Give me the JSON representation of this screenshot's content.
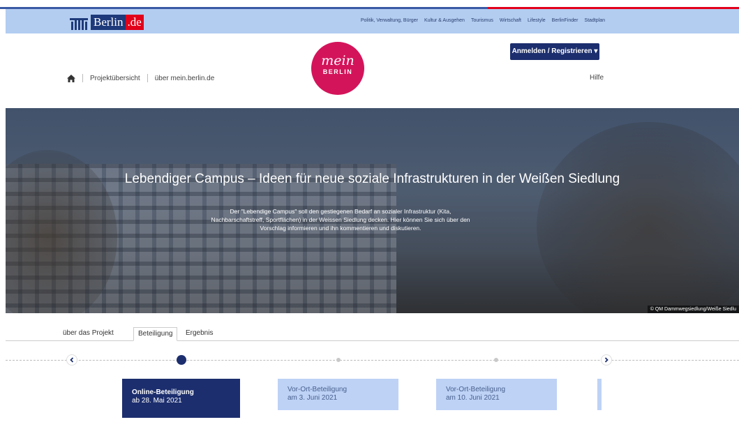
{
  "berlin_bar": {
    "logo_word": "Berlin",
    "logo_dot": ".de",
    "nav": [
      "Politik, Verwaltung, Bürger",
      "Kultur & Ausgehen",
      "Tourismus",
      "Wirtschaft",
      "Lifestyle",
      "BerlinFinder",
      "Stadtplan"
    ]
  },
  "header": {
    "nav_links": [
      "Projektübersicht",
      "über mein.berlin.de"
    ],
    "logo_top": "mein",
    "logo_bottom": "BERLIN",
    "login_label": "Anmelden / Registrieren ▾",
    "help_label": "Hilfe"
  },
  "hero": {
    "title": "Lebendiger Campus – Ideen für neue soziale Infrastrukturen in der Weißen Siedlung",
    "description": "Der \"Lebendige Campus\" soll den gestiegenen Bedarf an sozialer Infrastruktur (Kita, Nachbarschaftstreff, Sportflächen) in der Weissen Siedlung decken. Hier können Sie sich über den Vorschlag informieren und ihn kommentieren und diskutieren.",
    "credit": "© QM Dammwegsiedlung/Weiße Siedlu"
  },
  "tabs": [
    {
      "label": "über das Projekt",
      "active": false
    },
    {
      "label": "Beteiligung",
      "active": true
    },
    {
      "label": "Ergebnis",
      "active": false
    }
  ],
  "timeline": {
    "phases": [
      {
        "title": "Online-Beteiligung",
        "date": "ab 28. Mai 2021",
        "active": true
      },
      {
        "title": "Vor-Ort-Beteiligung",
        "date": "am 3. Juni 2021",
        "active": false
      },
      {
        "title": "Vor-Ort-Beteiligung",
        "date": "am 10. Juni 2021",
        "active": false
      }
    ]
  },
  "colors": {
    "brand_blue": "#1c2e6e",
    "berlin_bar": "#b3cdf1",
    "mein_berlin_pink": "#d4145a",
    "inactive_card": "#bdd2f5"
  },
  "icons": [
    "home-icon",
    "chevron-left-icon",
    "chevron-right-icon",
    "caret-down-icon"
  ]
}
